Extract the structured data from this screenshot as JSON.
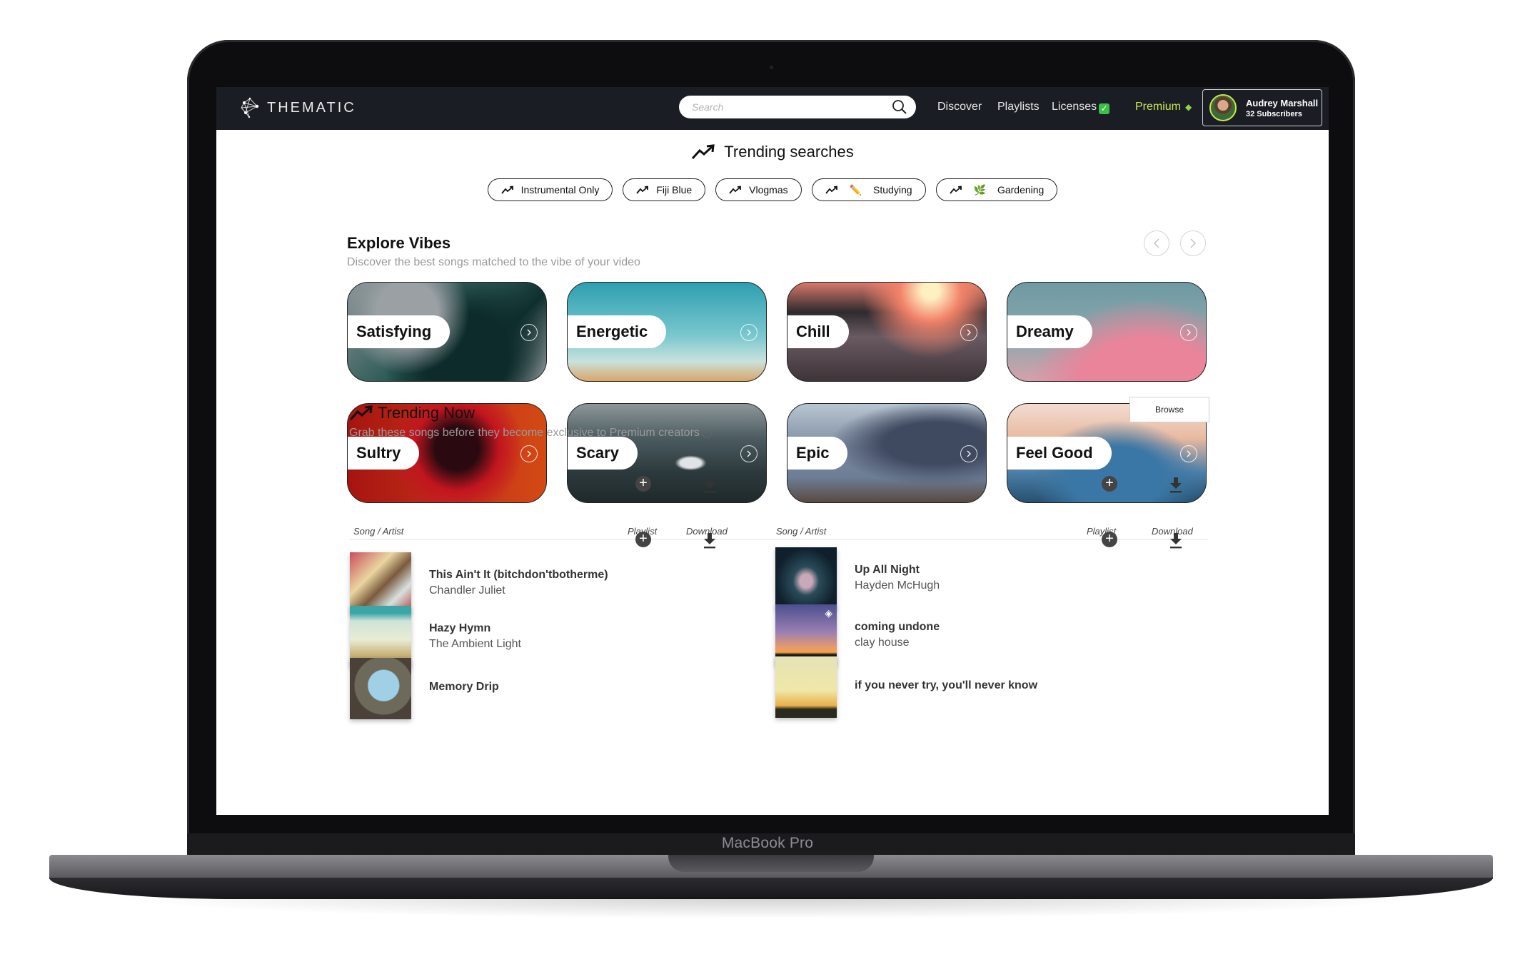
{
  "device": {
    "label": "MacBook Pro"
  },
  "navbar": {
    "brand": "THEMATIC",
    "search_placeholder": "Search",
    "links": {
      "discover": "Discover",
      "playlists": "Playlists",
      "licenses": "Licenses",
      "premium": "Premium"
    },
    "profile": {
      "name": "Audrey Marshall",
      "subscribers": "32 Subscribers"
    }
  },
  "trending_searches": {
    "title": "Trending searches",
    "chips": [
      {
        "label": "Instrumental Only",
        "emoji": ""
      },
      {
        "label": "Fiji Blue",
        "emoji": ""
      },
      {
        "label": "Vlogmas",
        "emoji": ""
      },
      {
        "label": "Studying",
        "emoji": "✏️"
      },
      {
        "label": "Gardening",
        "emoji": "🌿"
      }
    ]
  },
  "explore_vibes": {
    "title": "Explore Vibes",
    "subtitle": "Discover the best songs matched to the vibe of your video",
    "vibes": [
      {
        "label": "Satisfying"
      },
      {
        "label": "Energetic"
      },
      {
        "label": "Chill"
      },
      {
        "label": "Dreamy"
      },
      {
        "label": "Sultry"
      },
      {
        "label": "Scary"
      },
      {
        "label": "Epic"
      },
      {
        "label": "Feel Good"
      }
    ]
  },
  "trending_now": {
    "title": "Trending Now",
    "subtitle": "Grab these songs before they become exclusive to Premium creators",
    "browse_label": "Browse",
    "columns": {
      "song_artist": "Song / Artist",
      "playlist": "Playlist",
      "download": "Download"
    },
    "tracks_left": [
      {
        "title": "This Ain't It (bitchdon'tbotherme)",
        "artist": "Chandler Juliet"
      },
      {
        "title": "Hazy Hymn",
        "artist": "The Ambient Light"
      },
      {
        "title": "Memory Drip",
        "artist": ""
      }
    ],
    "tracks_right": [
      {
        "title": "Up All Night",
        "artist": "Hayden McHugh"
      },
      {
        "title": "coming undone",
        "artist": "clay house",
        "premium": true
      },
      {
        "title": "if you never try, you'll never know",
        "artist": ""
      }
    ]
  }
}
